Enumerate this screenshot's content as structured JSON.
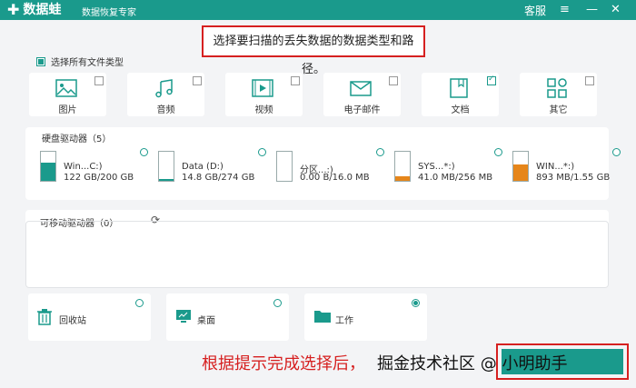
{
  "app": {
    "name": "数据蛙",
    "subtitle": "数据恢复专家",
    "service": "客服",
    "menu_icon": "≡",
    "minimize_icon": "—",
    "close_icon": "✕"
  },
  "instruction": "选择要扫描的丢失数据的数据类型和路径。",
  "select_all": "选择所有文件类型",
  "file_types": [
    {
      "label": "图片",
      "icon": "image-icon",
      "checked": false
    },
    {
      "label": "音频",
      "icon": "audio-icon",
      "checked": false
    },
    {
      "label": "视频",
      "icon": "video-icon",
      "checked": false
    },
    {
      "label": "电子邮件",
      "icon": "email-icon",
      "checked": false
    },
    {
      "label": "文档",
      "icon": "document-icon",
      "checked": true
    },
    {
      "label": "其它",
      "icon": "other-icon",
      "checked": false
    }
  ],
  "drives_section": {
    "title": "硬盘驱动器（5）",
    "drives": [
      {
        "name": "Win...C:)",
        "size": "122 GB/200 GB",
        "used_fraction": 0.61,
        "fill_color": "#1a9a8c"
      },
      {
        "name": "Data (D:)",
        "size": "14.8 GB/274 GB",
        "used_fraction": 0.05,
        "fill_color": "#1a9a8c"
      },
      {
        "name": "分区...:)",
        "size": "0.00  B/16.0 MB",
        "used_fraction": 0.0,
        "fill_color": "#f0a030"
      },
      {
        "name": "SYS...*:)",
        "size": "41.0 MB/256 MB",
        "used_fraction": 0.16,
        "fill_color": "#e6861a"
      },
      {
        "name": "WIN...*:)",
        "size": "893 MB/1.55 GB",
        "used_fraction": 0.57,
        "fill_color": "#e6861a"
      }
    ]
  },
  "removable_section": {
    "title": "可移动驱动器（0）",
    "refresh_icon": "⟳"
  },
  "locations": [
    {
      "label": "回收站",
      "icon": "trash-icon",
      "selected": false
    },
    {
      "label": "桌面",
      "icon": "desktop-icon",
      "selected": false
    },
    {
      "label": "工作",
      "icon": "folder-icon",
      "selected": true
    }
  ],
  "bottom_hint": "根据提示完成选择后，",
  "watermark": "掘金技术社区 @ 小明助手"
}
